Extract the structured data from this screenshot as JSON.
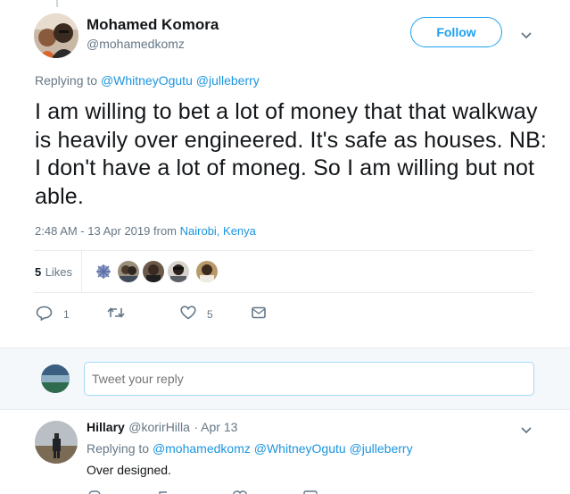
{
  "tweet": {
    "author_name": "Mohamed Komora",
    "author_handle": "@mohamedkomz",
    "follow_label": "Follow",
    "replying_prefix": "Replying to",
    "replying_to": [
      "@WhitneyOgutu",
      "@julleberry"
    ],
    "text": "I am willing to bet a lot of money that that walkway is heavily over engineered. It's safe as houses. NB: I don't have a lot of moneg. So I am willing but not able.",
    "timestamp": "2:48 AM - 13 Apr 2019",
    "from_label": "from",
    "location": "Nairobi, Kenya",
    "likes_count": "5",
    "likes_label": "Likes",
    "actions": {
      "reply_count": "1",
      "retweet_count": "",
      "like_count": "5"
    }
  },
  "reply_box": {
    "placeholder": "Tweet your reply"
  },
  "reply": {
    "author_name": "Hillary",
    "author_handle": "@korirHilla",
    "date": "· Apr 13",
    "replying_prefix": "Replying to",
    "replying_to": [
      "@mohamedkomz",
      "@WhitneyOgutu",
      "@julleberry"
    ],
    "text": "Over designed."
  },
  "colors": {
    "accent": "#1da1f2",
    "link": "#1b95e0",
    "muted": "#657786"
  }
}
